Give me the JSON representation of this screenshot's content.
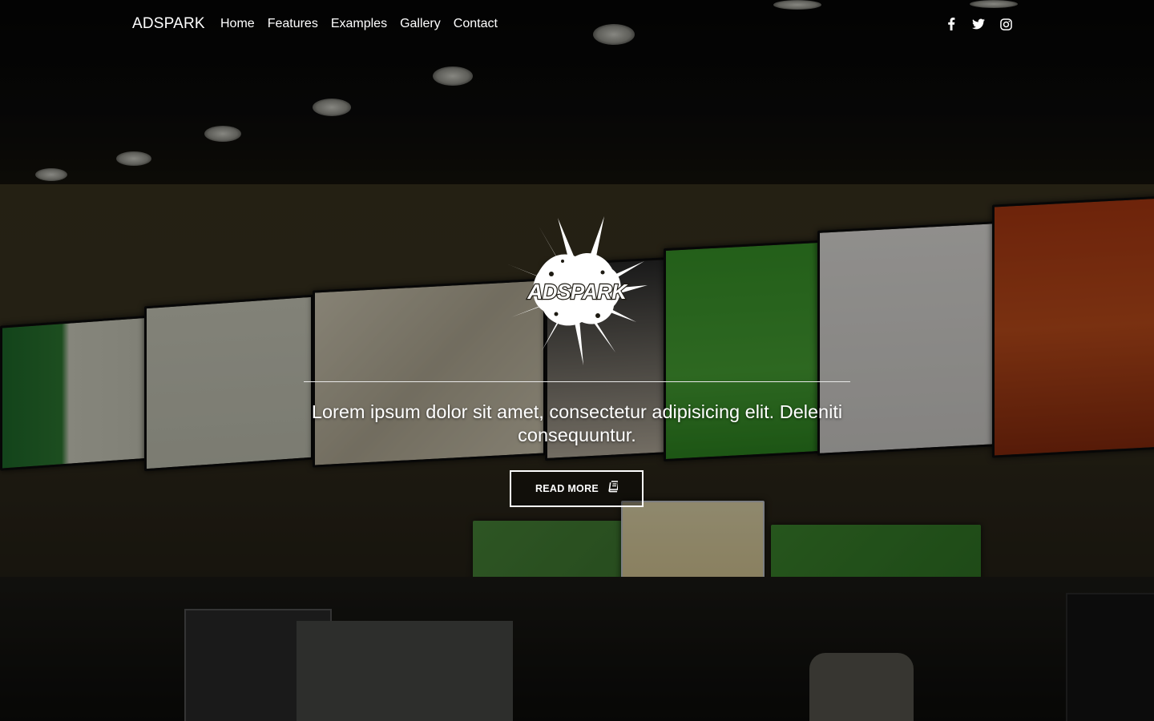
{
  "navbar": {
    "brand": "ADSPARK",
    "links": [
      "Home",
      "Features",
      "Examples",
      "Gallery",
      "Contact"
    ],
    "social_icons": [
      "facebook-icon",
      "twitter-icon",
      "instagram-icon"
    ]
  },
  "hero": {
    "logo_text": "ADSPARK",
    "tagline": "Lorem ipsum dolor sit amet, consectetur adipisicing elit. Deleniti consequuntur.",
    "button_label": "READ MORE",
    "button_icon": "book-icon"
  },
  "colors": {
    "text": "#ffffff",
    "overlay": "#000000"
  }
}
